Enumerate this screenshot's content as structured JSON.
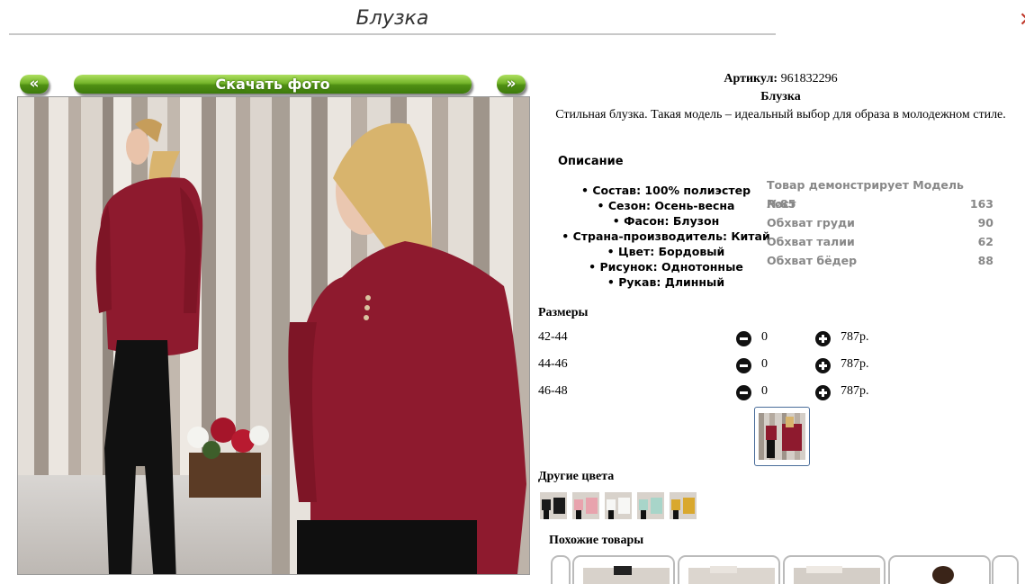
{
  "page": {
    "title": "Блузка"
  },
  "nav": {
    "prev_label": "«",
    "download_label": "Скачать фото",
    "next_label": "»"
  },
  "product": {
    "article_label": "Артикул:",
    "article_value": "961832296",
    "name": "Блузка",
    "tagline": "Стильная блузка. Такая модель – идеальный выбор для образа в молодежном стиле."
  },
  "description": {
    "title": "Описание",
    "items": [
      "Состав: 100% полиэстер",
      "Сезон: Осень-весна",
      "Фасон: Блузон",
      "Страна-производитель: Китай",
      "Цвет: Бордовый",
      "Рисунок: Однотонные",
      "Рукав: Длинный"
    ]
  },
  "model": {
    "title": "Товар демонстрирует Модель №85",
    "rows": [
      {
        "label": "Рост",
        "value": "163"
      },
      {
        "label": "Обхват груди",
        "value": "90"
      },
      {
        "label": "Обхват талии",
        "value": "62"
      },
      {
        "label": "Обхват бёдер",
        "value": "88"
      }
    ]
  },
  "sizes": {
    "title": "Размеры",
    "rows": [
      {
        "size": "42-44",
        "qty": "0",
        "price": "787р."
      },
      {
        "size": "44-46",
        "qty": "0",
        "price": "787р."
      },
      {
        "size": "46-48",
        "qty": "0",
        "price": "787р."
      }
    ]
  },
  "other_colors": {
    "title": "Другие цвета",
    "thumbs": [
      "black",
      "pink",
      "white",
      "mint",
      "mustard"
    ]
  },
  "similar": {
    "title": "Похожие товары"
  },
  "colors": {
    "button_green": "#5a9a1a",
    "blouse_burgundy": "#8e1a2e",
    "model_text_gray": "#888888",
    "thumb_border": "#4a6d9a"
  },
  "icons": {
    "minus": "minus-circle-icon",
    "plus": "plus-circle-icon",
    "close": "close-icon"
  }
}
